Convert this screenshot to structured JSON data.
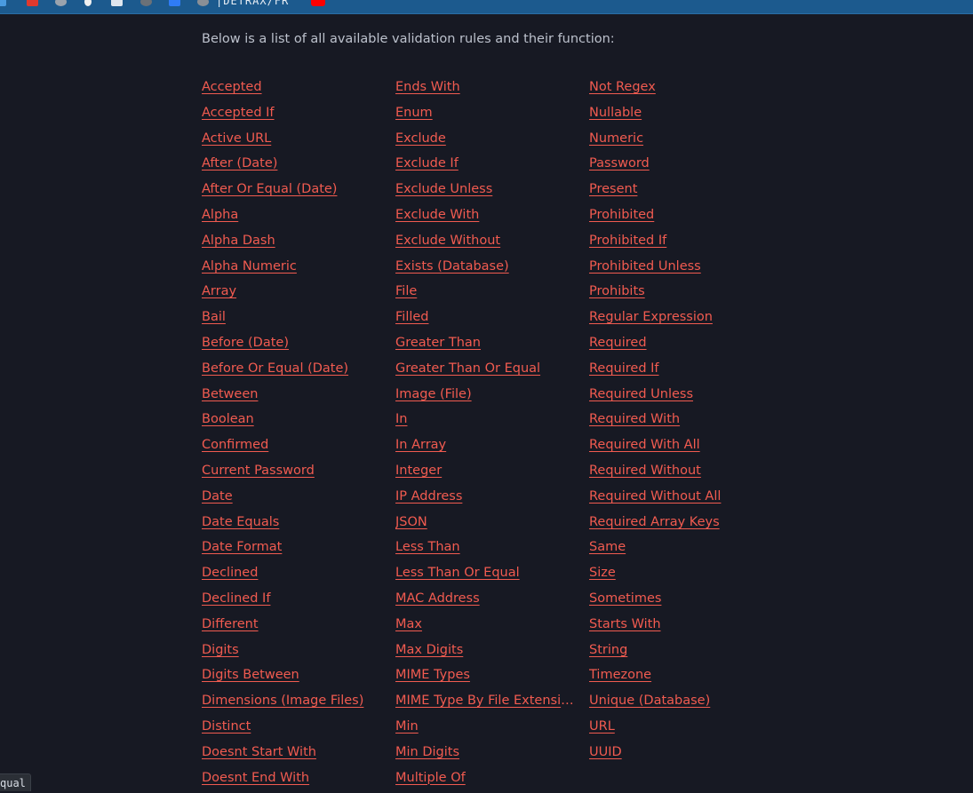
{
  "bookmarks_bar": {
    "items": [
      {
        "icon": "page-icon",
        "color": "#4a9be0"
      },
      {
        "icon": "red-square-icon",
        "color": "#e0392e"
      },
      {
        "icon": "gear-icon",
        "color": "#9aa3ad"
      },
      {
        "icon": "lightbulb-icon",
        "color": "#f0f0f0"
      },
      {
        "icon": "cube-icon",
        "color": "#dfe6ee"
      },
      {
        "icon": "github-icon",
        "color": "#6b7178"
      },
      {
        "icon": "arrows-icon",
        "color": "#2f7cf6"
      },
      {
        "icon": "circle-icon",
        "color": "#8a8f96"
      }
    ],
    "folder_label": "|DETRAX/FR",
    "youtube_icon_color": "#ff0000"
  },
  "intro_text": "Below is a list of all available validation rules and their function:",
  "rules": {
    "columns": [
      [
        "Accepted",
        "Accepted If",
        "Active URL",
        "After (Date)",
        "After Or Equal (Date)",
        "Alpha",
        "Alpha Dash",
        "Alpha Numeric",
        "Array",
        "Bail",
        "Before (Date)",
        "Before Or Equal (Date)",
        "Between",
        "Boolean",
        "Confirmed",
        "Current Password",
        "Date",
        "Date Equals",
        "Date Format",
        "Declined",
        "Declined If",
        "Different",
        "Digits",
        "Digits Between",
        "Dimensions (Image Files)",
        "Distinct",
        "Doesnt Start With",
        "Doesnt End With"
      ],
      [
        "Ends With",
        "Enum",
        "Exclude",
        "Exclude If",
        "Exclude Unless",
        "Exclude With",
        "Exclude Without",
        "Exists (Database)",
        "File",
        "Filled",
        "Greater Than",
        "Greater Than Or Equal",
        "Image (File)",
        "In",
        "In Array",
        "Integer",
        "IP Address",
        "JSON",
        "Less Than",
        "Less Than Or Equal",
        "MAC Address",
        "Max",
        "Max Digits",
        "MIME Types",
        "MIME Type By File Extension",
        "Min",
        "Min Digits",
        "Multiple Of"
      ],
      [
        "Not Regex",
        "Nullable",
        "Numeric",
        "Password",
        "Present",
        "Prohibited",
        "Prohibited If",
        "Prohibited Unless",
        "Prohibits",
        "Regular Expression",
        "Required",
        "Required If",
        "Required Unless",
        "Required With",
        "Required With All",
        "Required Without",
        "Required Without All",
        "Required Array Keys",
        "Same",
        "Size",
        "Sometimes",
        "Starts With",
        "String",
        "Timezone",
        "Unique (Database)",
        "URL",
        "UUID"
      ]
    ]
  },
  "status_bar": {
    "url_text": "qual"
  },
  "colors": {
    "background": "#171923",
    "link": "#f15b50",
    "text": "#bcc1cc"
  }
}
